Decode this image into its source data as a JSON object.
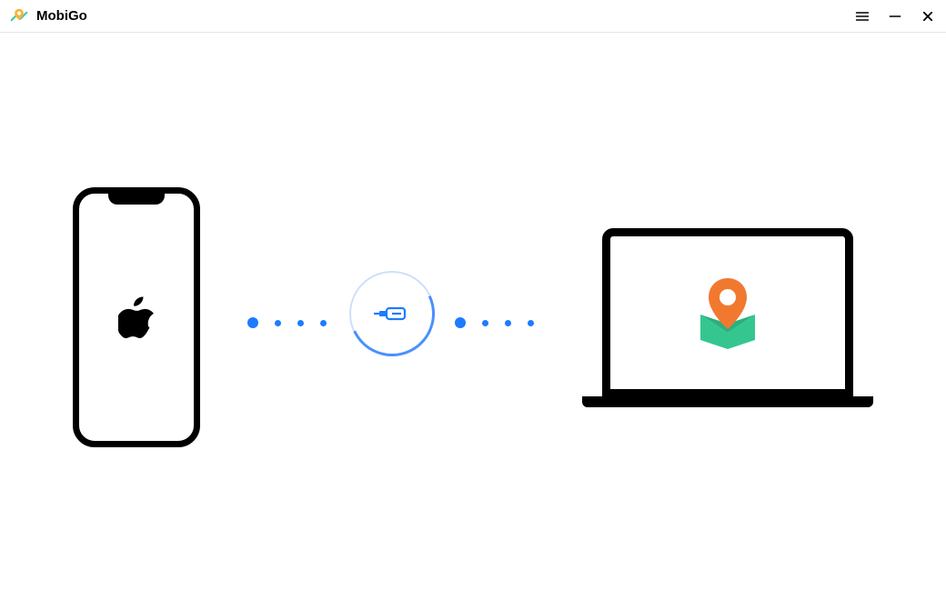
{
  "header": {
    "app_name": "MobiGo",
    "logo_name": "mobigo-logo",
    "menu_icon": "hamburger-menu",
    "minimize_icon": "minimize",
    "close_icon": "close"
  },
  "content": {
    "phone_icon": "iphone-device",
    "phone_logo": "apple-logo",
    "connector_icon": "usb-plug",
    "laptop_icon": "laptop-device",
    "laptop_app_icon": "map-pin-location",
    "colors": {
      "dot": "#1d7bff",
      "accent_green": "#35c690",
      "accent_orange": "#f1792f"
    }
  }
}
